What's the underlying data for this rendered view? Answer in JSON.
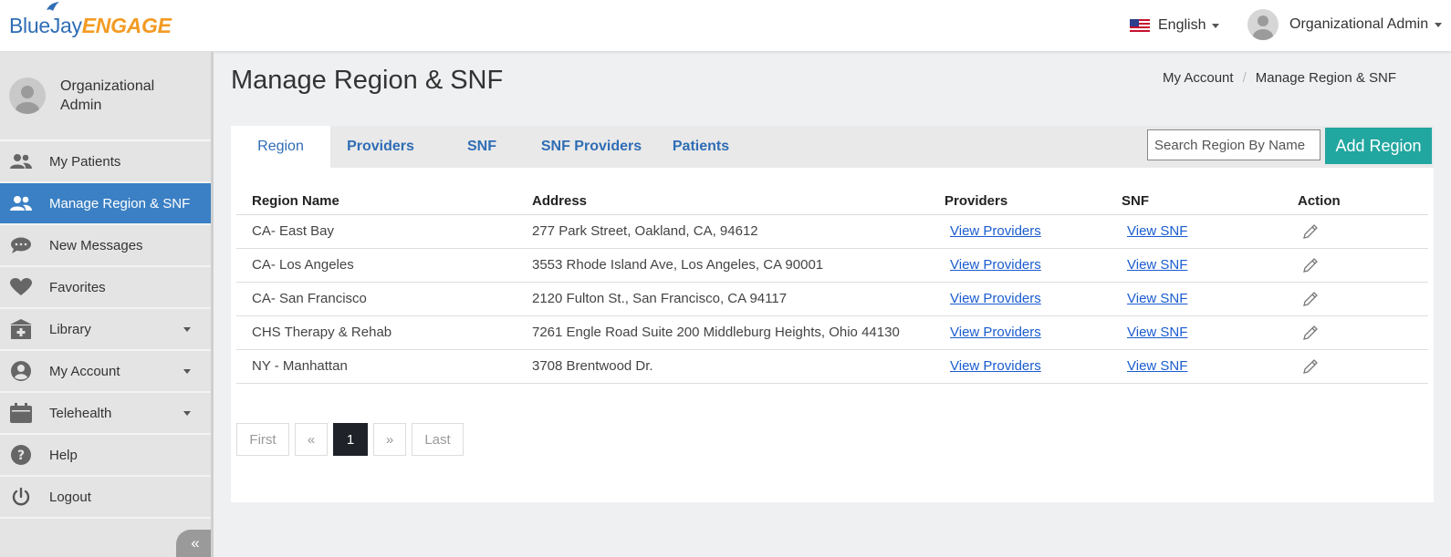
{
  "header": {
    "logo_part1": "BlueJay",
    "logo_part2": "ENGAGE",
    "language": "English",
    "user_name": "Organizational Admin"
  },
  "sidebar": {
    "profile_name": "Organizational Admin",
    "items": [
      {
        "label": "My Patients",
        "icon": "users-icon"
      },
      {
        "label": "Manage Region & SNF",
        "icon": "users-icon",
        "active": true
      },
      {
        "label": "New Messages",
        "icon": "chat-icon"
      },
      {
        "label": "Favorites",
        "icon": "heart-icon"
      },
      {
        "label": "Library",
        "icon": "library-icon",
        "dropdown": true
      },
      {
        "label": "My Account",
        "icon": "account-icon",
        "dropdown": true
      },
      {
        "label": "Telehealth",
        "icon": "calendar-icon",
        "dropdown": true
      },
      {
        "label": "Help",
        "icon": "help-icon"
      },
      {
        "label": "Logout",
        "icon": "power-icon"
      }
    ],
    "collapse_label": "«"
  },
  "main": {
    "title": "Manage Region & SNF",
    "breadcrumb": [
      "My Account",
      "/",
      "Manage Region & SNF"
    ],
    "tabs": [
      {
        "label": "Region",
        "active": true
      },
      {
        "label": "Providers"
      },
      {
        "label": "SNF"
      },
      {
        "label": "SNF Providers"
      },
      {
        "label": "Patients"
      }
    ],
    "search_placeholder": "Search Region By Name",
    "add_button": "Add Region",
    "table": {
      "columns": [
        "Region Name",
        "Address",
        "Providers",
        "SNF",
        "Action"
      ],
      "rows": [
        {
          "name": "CA- East Bay",
          "address": "277 Park Street, Oakland, CA, 94612",
          "providers": "View Providers",
          "snf": "View SNF"
        },
        {
          "name": "CA- Los Angeles",
          "address": "3553 Rhode Island Ave, Los Angeles, CA 90001",
          "providers": "View Providers",
          "snf": "View SNF"
        },
        {
          "name": "CA- San Francisco",
          "address": "2120 Fulton St., San Francisco, CA 94117",
          "providers": "View Providers",
          "snf": "View SNF"
        },
        {
          "name": "CHS Therapy & Rehab",
          "address": "7261 Engle Road Suite 200 Middleburg Heights, Ohio 44130",
          "providers": "View Providers",
          "snf": "View SNF"
        },
        {
          "name": "NY - Manhattan",
          "address": "3708 Brentwood Dr.",
          "providers": "View Providers",
          "snf": "View SNF"
        }
      ]
    },
    "pagination": {
      "first": "First",
      "prev": "«",
      "current": "1",
      "next": "»",
      "last": "Last"
    }
  },
  "colors": {
    "accent_blue": "#3b80c4",
    "link_blue": "#1a5ccf",
    "teal_button": "#22a6a0",
    "logo_orange": "#f39b23"
  }
}
